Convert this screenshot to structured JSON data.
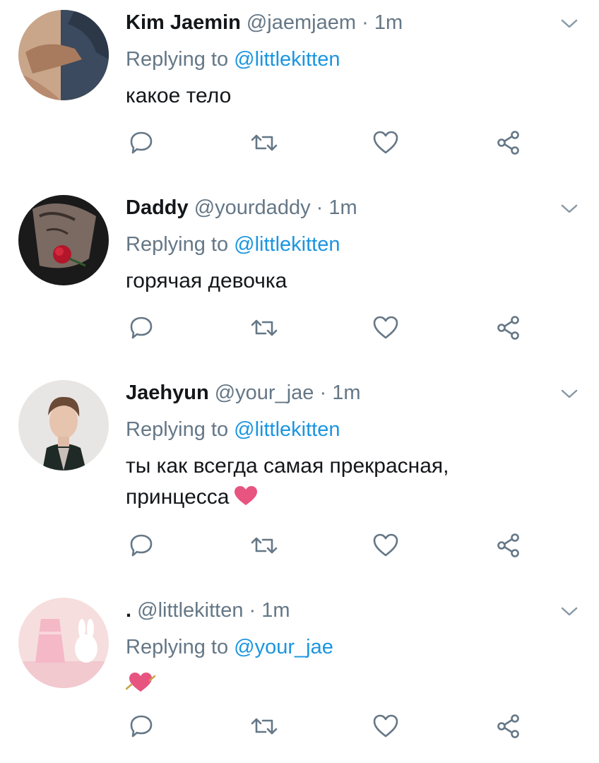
{
  "tweets": [
    {
      "name": "Kim Jaemin",
      "handle": "@jaemjaem",
      "dot": "·",
      "time": "1m",
      "replying_prefix": "Replying to",
      "replying_to": "@littlekitten",
      "text": "какое тело",
      "emoji": ""
    },
    {
      "name": "Daddy",
      "handle": "@yourdaddy",
      "dot": "·",
      "time": "1m",
      "replying_prefix": "Replying to",
      "replying_to": "@littlekitten",
      "text": "горячая девочка",
      "emoji": ""
    },
    {
      "name": "Jaehyun",
      "handle": "@your_jae",
      "dot": "·",
      "time": "1m",
      "replying_prefix": "Replying to",
      "replying_to": "@littlekitten",
      "text": "ты как всегда самая прекрасная, принцесса",
      "emoji": "heart"
    },
    {
      "name": ".",
      "handle": "@littlekitten",
      "dot": "·",
      "time": "1m",
      "replying_prefix": "Replying to",
      "replying_to": "@your_jae",
      "text": "",
      "emoji": "heart-with-arrow"
    }
  ],
  "actions": [
    "reply-icon",
    "retweet-icon",
    "like-icon",
    "share-icon"
  ],
  "colors": {
    "text": "#14171a",
    "muted": "#657786",
    "link": "#1b95e0",
    "icon": "#657786",
    "heart_emoji": "#e75480"
  }
}
